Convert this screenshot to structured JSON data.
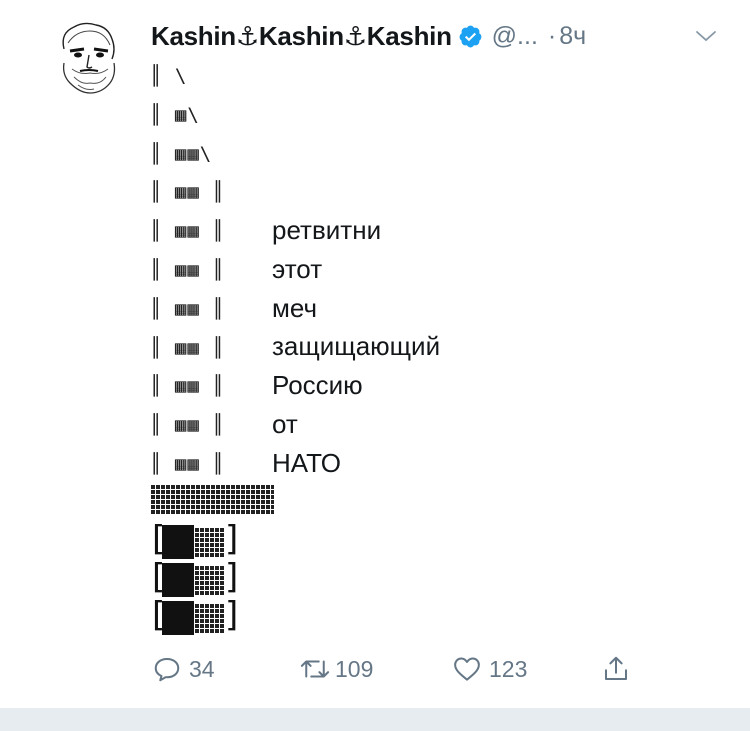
{
  "tweet": {
    "display_name": "Kashin⚓Kashin⚓Kashin",
    "handle": "@...",
    "dot": "·",
    "time": "8ч",
    "art": "║ \\\n║ ▦\\\n║ ▦▦\\\n║ ▦▦ ║\n║ ▦▦ ║\n║ ▦▦ ║\n║ ▦▦ ║\n║ ▦▦ ║\n║ ▦▦ ║\n║ ▦▦ ║\n║ ▦▦ ║",
    "words": [
      "ретвитни",
      "этот",
      "меч",
      "защищающий",
      "Россию",
      "от",
      "НАТО"
    ],
    "hilt_left": "[",
    "hilt_right": "]"
  },
  "actions": {
    "reply_count": "34",
    "retweet_count": "109",
    "like_count": "123"
  },
  "colors": {
    "verified": "#1da1f2",
    "muted": "#657786",
    "text": "#14171a"
  },
  "icons": [
    "avatar-portrait",
    "verified-badge-icon",
    "chevron-down-icon",
    "reply-icon",
    "retweet-icon",
    "like-icon",
    "share-icon"
  ]
}
